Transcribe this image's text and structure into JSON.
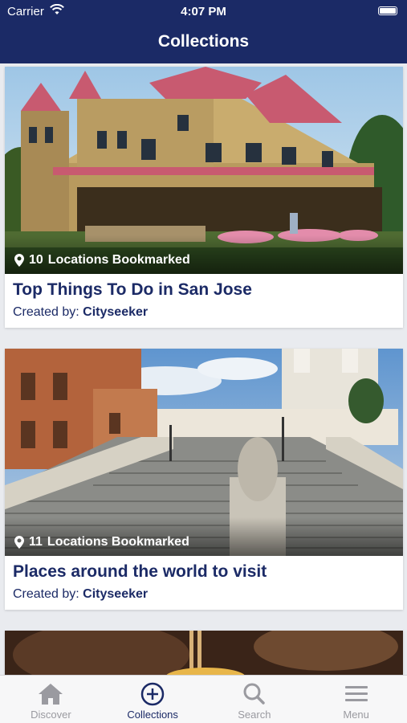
{
  "status": {
    "carrier": "Carrier",
    "time": "4:07 PM"
  },
  "header": {
    "title": "Collections"
  },
  "cards": [
    {
      "count": "10",
      "count_label": "Locations Bookmarked",
      "title": "Top Things To Do in San Jose",
      "creator_prefix": "Created by:",
      "creator": "Cityseeker"
    },
    {
      "count": "11",
      "count_label": "Locations Bookmarked",
      "title": "Places around the world to visit",
      "creator_prefix": "Created by:",
      "creator": "Cityseeker"
    }
  ],
  "tabs": {
    "discover": "Discover",
    "collections": "Collections",
    "search": "Search",
    "menu": "Menu"
  },
  "colors": {
    "primary": "#1b2a66",
    "inactive": "#9a9aa0"
  }
}
